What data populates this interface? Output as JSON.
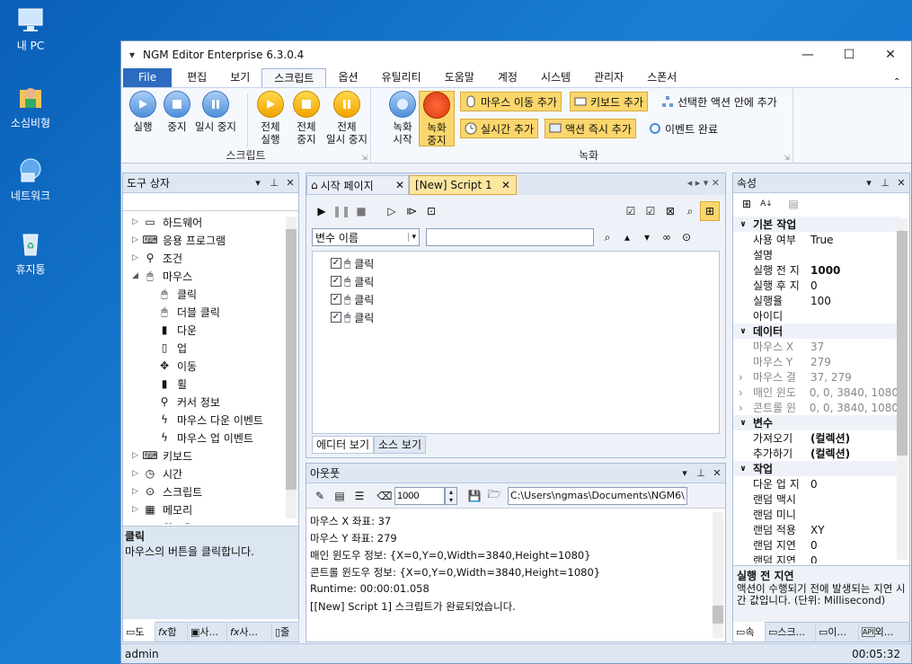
{
  "desktop": {
    "icons": [
      {
        "label": "내 PC"
      },
      {
        "label": "소심비형"
      },
      {
        "label": "네트워크"
      },
      {
        "label": "휴지통"
      }
    ]
  },
  "window": {
    "title": "NGM Editor  Enterprise 6.3.0.4"
  },
  "menu": {
    "file": "File",
    "items": [
      "편집",
      "보기",
      "스크립트",
      "옵션",
      "유틸리티",
      "도움말",
      "계정",
      "시스템",
      "관리자",
      "스폰서"
    ]
  },
  "ribbon": {
    "script_group": {
      "label": "스크립트",
      "run": "실행",
      "stop": "중지",
      "pause": "일시 중지",
      "run_all": "전체\n실행",
      "stop_all": "전체\n중지",
      "pause_all": "전체\n일시 중지"
    },
    "record_group": {
      "label": "녹화",
      "rec_start": "녹화\n시작",
      "rec_stop": "녹화\n중지",
      "add_mouse": "마우스 이동 추가",
      "add_keyboard": "키보드 추가",
      "add_inside": "선택한 액션 안에 추가",
      "add_realtime": "실시간 추가",
      "add_action_now": "액션 즉시 추가",
      "event_complete": "이벤트 완료"
    }
  },
  "toolbox": {
    "title": "도구 상자",
    "items": [
      {
        "label": "하드웨어",
        "level": 0,
        "expander": "▷",
        "icon": "monitor-icon"
      },
      {
        "label": "응용 프로그램",
        "level": 0,
        "expander": "▷",
        "icon": "terminal-icon"
      },
      {
        "label": "조건",
        "level": 0,
        "expander": "▷",
        "icon": "condition-icon"
      },
      {
        "label": "마우스",
        "level": 0,
        "expander": "◢",
        "icon": "mouse-icon"
      },
      {
        "label": "클릭",
        "level": 1,
        "expander": "",
        "icon": "click-icon"
      },
      {
        "label": "더블 클릭",
        "level": 1,
        "expander": "",
        "icon": "double-click-icon"
      },
      {
        "label": "다운",
        "level": 1,
        "expander": "",
        "icon": "mouse-down-icon"
      },
      {
        "label": "업",
        "level": 1,
        "expander": "",
        "icon": "mouse-up-icon"
      },
      {
        "label": "이동",
        "level": 1,
        "expander": "",
        "icon": "move-icon"
      },
      {
        "label": "휠",
        "level": 1,
        "expander": "",
        "icon": "wheel-icon"
      },
      {
        "label": "커서 정보",
        "level": 1,
        "expander": "",
        "icon": "cursor-info-icon"
      },
      {
        "label": "마우스 다운 이벤트",
        "level": 1,
        "expander": "",
        "icon": "lightning-icon"
      },
      {
        "label": "마우스 업 이벤트",
        "level": 1,
        "expander": "",
        "icon": "lightning-icon"
      },
      {
        "label": "키보드",
        "level": 0,
        "expander": "▷",
        "icon": "keyboard-icon"
      },
      {
        "label": "시간",
        "level": 0,
        "expander": "▷",
        "icon": "clock-icon"
      },
      {
        "label": "스크립트",
        "level": 0,
        "expander": "▷",
        "icon": "script-icon"
      },
      {
        "label": "메모리",
        "level": 0,
        "expander": "▷",
        "icon": "memory-icon"
      },
      {
        "label": "윈도우",
        "level": 0,
        "expander": "▷",
        "icon": "window-icon"
      }
    ],
    "desc_title": "클릭",
    "desc_text": "마우스의 버튼을 클릭합니다.",
    "bottom_tabs": [
      "도",
      "함",
      "사...",
      "사...",
      "줄"
    ]
  },
  "editor": {
    "tabs": [
      {
        "label": "시작 페이지"
      },
      {
        "label": "[New] Script 1"
      }
    ],
    "var_dropdown": "변수 이름",
    "search_value": "",
    "actions": [
      "클릭",
      "클릭",
      "클릭",
      "클릭"
    ],
    "bottom_tabs": [
      "에디터 보기",
      "소스 보기"
    ]
  },
  "output": {
    "title": "아웃풋",
    "interval": "1000",
    "path": "C:\\Users\\ngmas\\Documents\\NGM6\\",
    "lines": [
      "마우스 X 좌표: 37",
      "마우스 Y 좌표: 279",
      "매인 윈도우 정보: {X=0,Y=0,Width=3840,Height=1080}",
      "콘트롤 윈도우 정보: {X=0,Y=0,Width=3840,Height=1080}",
      "Runtime: 00:00:01.058",
      "[[New] Script 1] 스크립트가 완료되었습니다."
    ]
  },
  "properties": {
    "title": "속성",
    "rows": [
      {
        "type": "cat",
        "name": "기본 작업"
      },
      {
        "type": "row",
        "name": "사용 여부",
        "value": "True"
      },
      {
        "type": "row",
        "name": "설명",
        "value": ""
      },
      {
        "type": "row",
        "name": "실행 전 지",
        "value": "1000",
        "bold": true
      },
      {
        "type": "row",
        "name": "실행 후 지",
        "value": "0"
      },
      {
        "type": "row",
        "name": "실행율",
        "value": "100"
      },
      {
        "type": "row",
        "name": "아이디",
        "value": ""
      },
      {
        "type": "cat",
        "name": "데이터"
      },
      {
        "type": "row",
        "name": "마우스 X",
        "value": "37",
        "dis": true
      },
      {
        "type": "row",
        "name": "마우스 Y",
        "value": "279",
        "dis": true
      },
      {
        "type": "row",
        "name": "마우스 결",
        "value": "37, 279",
        "dis": true,
        "exp": true
      },
      {
        "type": "row",
        "name": "매인 윈도",
        "value": "0, 0, 3840, 1080",
        "dis": true,
        "exp": true
      },
      {
        "type": "row",
        "name": "콘트롤 윈",
        "value": "0, 0, 3840, 1080",
        "dis": true,
        "exp": true
      },
      {
        "type": "cat",
        "name": "변수"
      },
      {
        "type": "row",
        "name": "가져오기",
        "value": "(컬렉션)",
        "bold": true
      },
      {
        "type": "row",
        "name": "추가하기",
        "value": "(컬렉션)",
        "bold": true
      },
      {
        "type": "cat",
        "name": "작업"
      },
      {
        "type": "row",
        "name": "다운 업 지",
        "value": "0"
      },
      {
        "type": "row",
        "name": "랜덤 맥시",
        "value": ""
      },
      {
        "type": "row",
        "name": "랜덤 미니",
        "value": ""
      },
      {
        "type": "row",
        "name": "랜덤 적용",
        "value": "XY"
      },
      {
        "type": "row",
        "name": "랜덤 지연",
        "value": "0"
      },
      {
        "type": "row",
        "name": "랜덤 지연",
        "value": "0"
      }
    ],
    "desc_title": "실행 전 지연",
    "desc_text": "액션이 수행되기 전에 발생되는 지연 시간 값입니다. (단위: Millisecond)",
    "bottom_tabs": [
      "속",
      "스크...",
      "이...",
      "외..."
    ]
  },
  "status": {
    "user": "admin",
    "time": "00:05:32"
  }
}
